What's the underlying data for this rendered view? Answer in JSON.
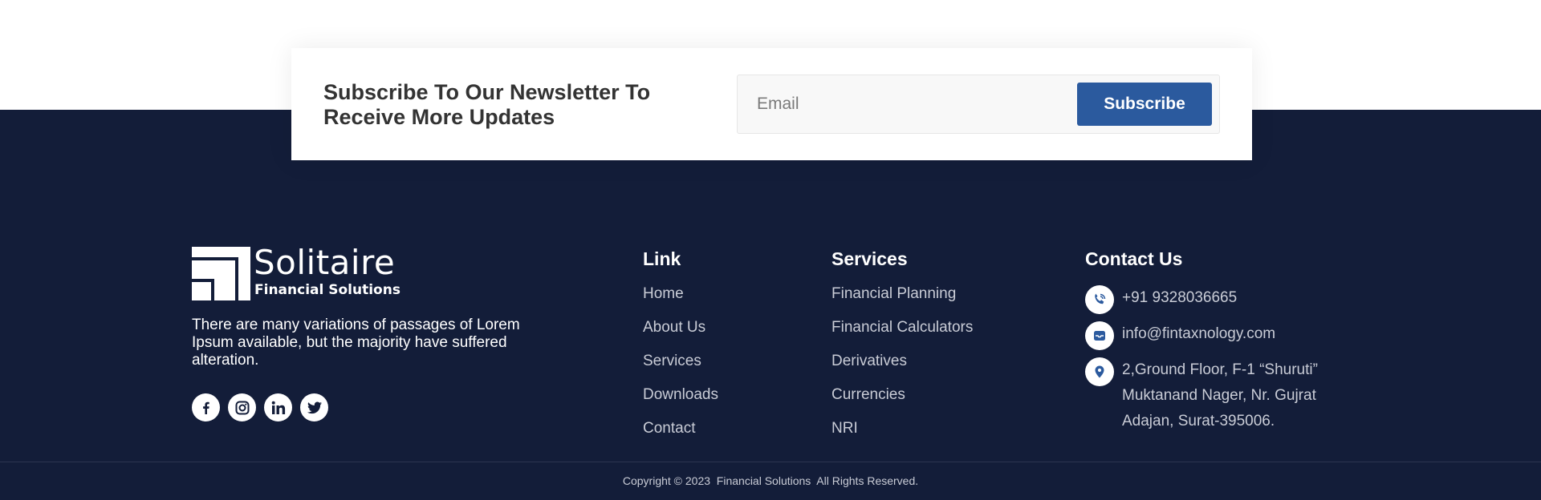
{
  "newsletter": {
    "title": "Subscribe To Our Newsletter To Receive More Updates",
    "email_placeholder": "Email",
    "email_value": "",
    "button_label": "Subscribe"
  },
  "brand": {
    "name": "Solitaire",
    "subtitle": "Financial Solutions",
    "description": "There are many variations of passages of Lorem Ipsum available, but the majority have suffered alteration.",
    "socials": [
      "facebook-icon",
      "instagram-icon",
      "linkedin-icon",
      "twitter-icon"
    ]
  },
  "links": {
    "title": "Link",
    "items": [
      "Home",
      "About Us",
      "Services",
      "Downloads",
      "Contact"
    ]
  },
  "services": {
    "title": "Services",
    "items": [
      "Financial Planning",
      "Financial Calculators",
      "Derivatives",
      "Currencies",
      "NRI"
    ]
  },
  "contact": {
    "title": "Contact Us",
    "phone": "+91 9328036665",
    "email": "info@fintaxnology.com",
    "address": "2,Ground Floor, F-1 “Shuruti” Muktanand Nager, Nr. Gujrat Adajan, Surat-395006."
  },
  "copyright": "Copyright © 2023  Financial Solutions  All Rights Reserved.",
  "colors": {
    "footer_bg": "#131d39",
    "accent": "#2b5a9e",
    "white": "#ffffff"
  }
}
